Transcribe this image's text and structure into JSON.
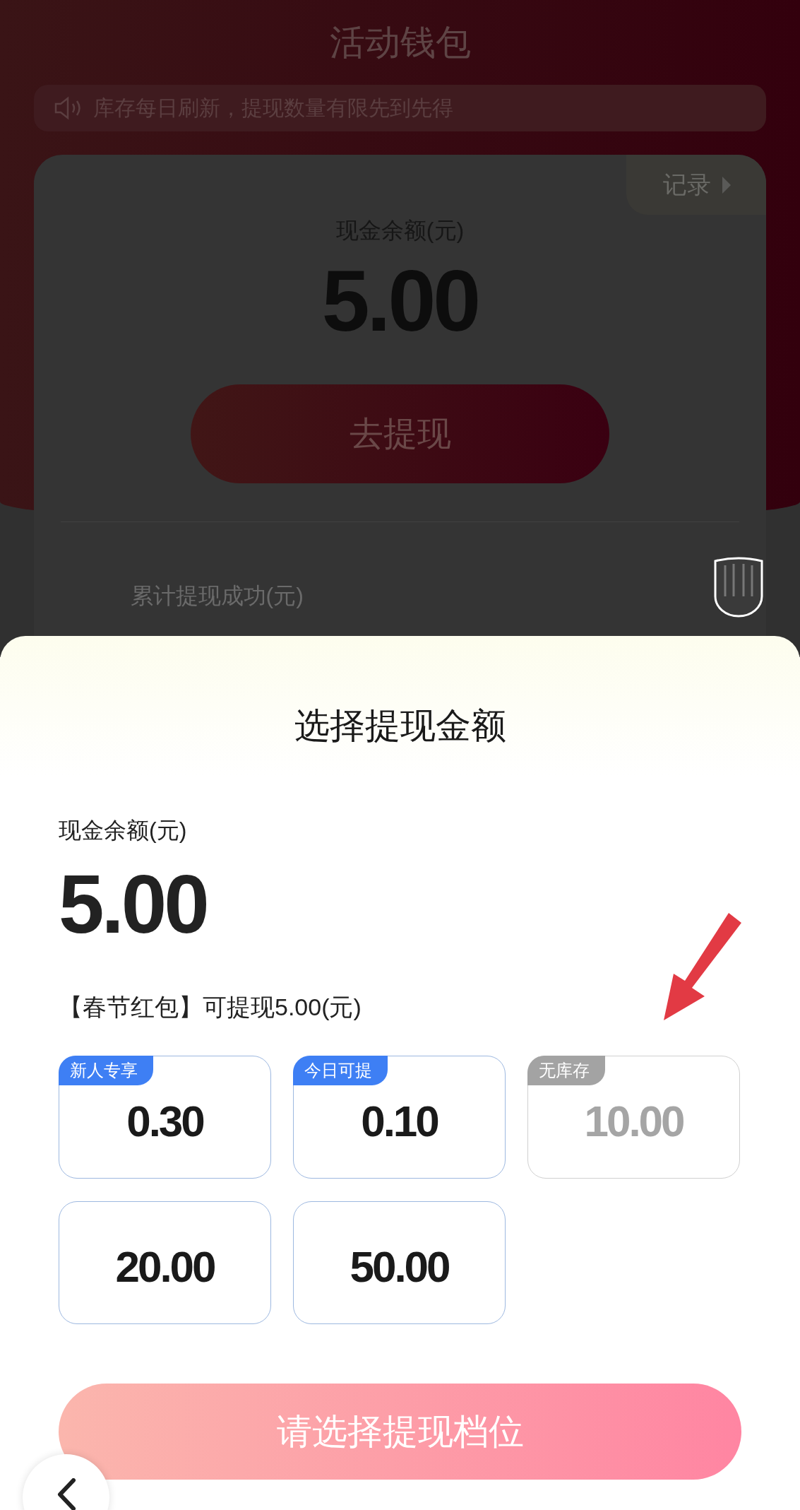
{
  "background_page": {
    "title": "活动钱包",
    "notice": "库存每日刷新，提现数量有限先到先得",
    "record_link": "记录",
    "balance_label": "现金余额(元)",
    "balance": "5.00",
    "withdraw_button": "去提现",
    "stats": [
      {
        "label": "累计提现成功(元)"
      }
    ]
  },
  "sheet": {
    "title": "选择提现金额",
    "balance_label": "现金余额(元)",
    "balance": "5.00",
    "note": "【春节红包】可提现5.00(元)",
    "options": [
      {
        "amount": "0.30",
        "tag": "新人专享",
        "disabled": false
      },
      {
        "amount": "0.10",
        "tag": "今日可提",
        "disabled": false
      },
      {
        "amount": "10.00",
        "tag": "无库存",
        "disabled": true
      },
      {
        "amount": "20.00",
        "disabled": false
      },
      {
        "amount": "50.00",
        "disabled": false
      }
    ],
    "confirm_button": "请选择提现档位"
  }
}
